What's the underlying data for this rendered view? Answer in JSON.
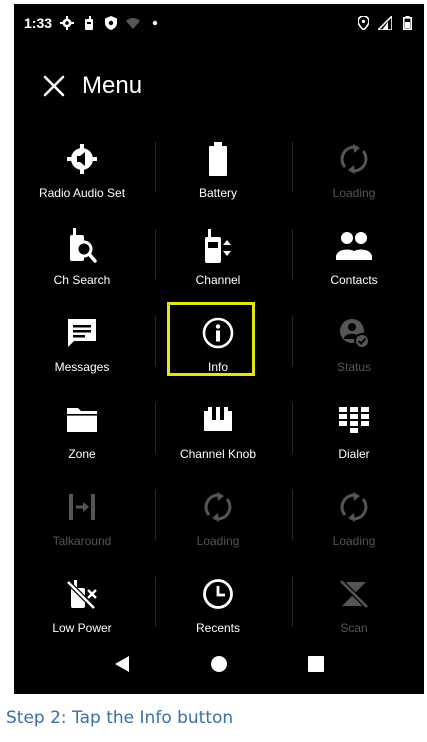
{
  "status_bar": {
    "time": "1:33"
  },
  "header": {
    "title": "Menu"
  },
  "menu": {
    "items": [
      {
        "label": "Radio Audio Set",
        "icon": "speaker-gear-icon",
        "enabled": true
      },
      {
        "label": "Battery",
        "icon": "battery-icon",
        "enabled": true
      },
      {
        "label": "Loading",
        "icon": "loading-icon",
        "enabled": false
      },
      {
        "label": "Ch Search",
        "icon": "channel-search-icon",
        "enabled": true
      },
      {
        "label": "Channel",
        "icon": "radio-channel-icon",
        "enabled": true
      },
      {
        "label": "Contacts",
        "icon": "contacts-icon",
        "enabled": true
      },
      {
        "label": "Messages",
        "icon": "message-icon",
        "enabled": true
      },
      {
        "label": "Info",
        "icon": "info-icon",
        "enabled": true,
        "highlighted": true
      },
      {
        "label": "Status",
        "icon": "status-icon",
        "enabled": false
      },
      {
        "label": "Zone",
        "icon": "folder-icon",
        "enabled": true
      },
      {
        "label": "Channel Knob",
        "icon": "channel-knob-icon",
        "enabled": true
      },
      {
        "label": "Dialer",
        "icon": "dialpad-icon",
        "enabled": true
      },
      {
        "label": "Talkaround",
        "icon": "talkaround-icon",
        "enabled": false
      },
      {
        "label": "Loading",
        "icon": "loading-icon",
        "enabled": false
      },
      {
        "label": "Loading",
        "icon": "loading-icon",
        "enabled": false
      },
      {
        "label": "Low Power",
        "icon": "low-power-icon",
        "enabled": true
      },
      {
        "label": "Recents",
        "icon": "clock-icon",
        "enabled": true
      },
      {
        "label": "Scan",
        "icon": "scan-icon",
        "enabled": false
      }
    ]
  },
  "caption": "Step 2: Tap the Info button",
  "colors": {
    "highlight": "#e5e510",
    "caption": "#3b6ea5",
    "disabled": "#555555"
  }
}
